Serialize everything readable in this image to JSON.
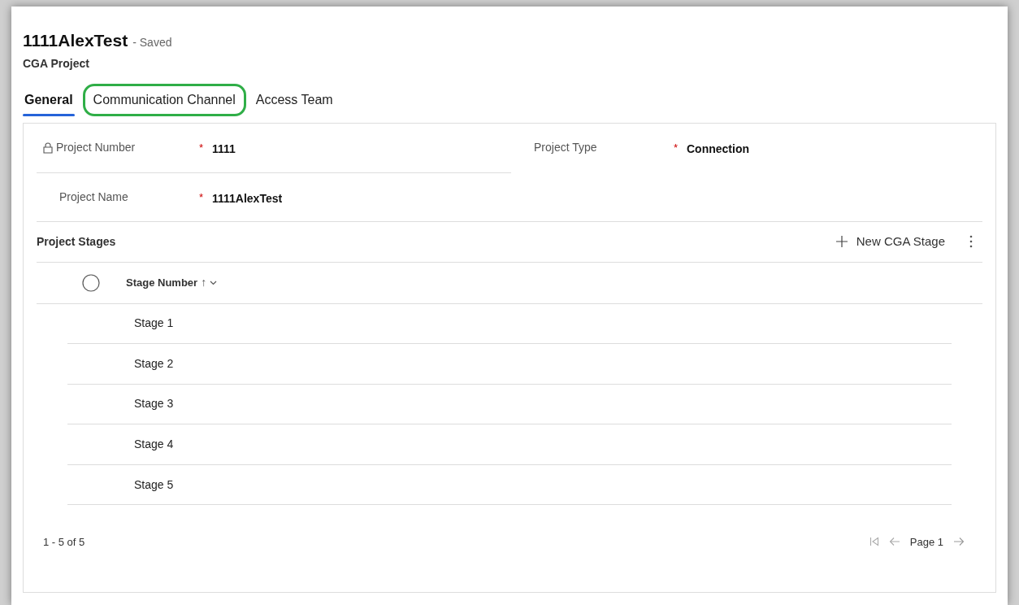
{
  "header": {
    "title": "1111AlexTest",
    "save_status": "- Saved",
    "entity": "CGA Project"
  },
  "tabs": [
    {
      "label": "General",
      "selected": true,
      "highlighted": false
    },
    {
      "label": "Communication Channel",
      "selected": false,
      "highlighted": true
    },
    {
      "label": "Access Team",
      "selected": false,
      "highlighted": false
    }
  ],
  "fields": [
    {
      "label": "Project Number",
      "required_mark": "*",
      "locked": true,
      "value": "1111"
    },
    {
      "label": "Project Type",
      "required_mark": "*",
      "locked": false,
      "value": "Connection"
    },
    {
      "label": "Project Name",
      "required_mark": "*",
      "locked": false,
      "value": "1111AlexTest"
    }
  ],
  "subgrid": {
    "title": "Project Stages",
    "new_button": "New CGA Stage",
    "select_all_checked": false,
    "column": "Stage Number",
    "sort_arrow": "↑",
    "rows": [
      "Stage 1",
      "Stage 2",
      "Stage 3",
      "Stage 4",
      "Stage 5"
    ],
    "record_count": "1 - 5 of 5",
    "page": "Page 1"
  }
}
